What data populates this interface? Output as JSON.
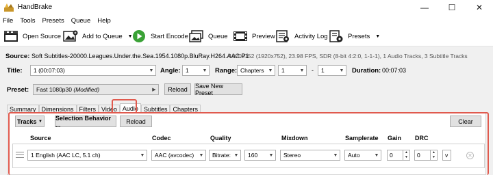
{
  "app": {
    "title": "HandBrake"
  },
  "menu": [
    "File",
    "Tools",
    "Presets",
    "Queue",
    "Help"
  ],
  "toolbar": {
    "open_source": "Open Source",
    "add_to_queue": "Add to Queue",
    "start_encode": "Start Encode",
    "queue": "Queue",
    "preview": "Preview",
    "activity_log": "Activity Log",
    "presets": "Presets"
  },
  "source": {
    "label": "Source:",
    "name": "Soft Subtitles-20000.Leagues.Under.the.Sea.1954.1080p.BluRay.H264.AAC.P1",
    "info": "1920x752 (1920x752), 23.98 FPS, SDR (8-bit 4:2:0, 1-1-1), 1 Audio Tracks, 3 Subtitle Tracks"
  },
  "title_row": {
    "title_label": "Title:",
    "title_value": "1 (00:07:03)",
    "angle_label": "Angle:",
    "angle_value": "1",
    "range_label": "Range:",
    "range_type": "Chapters",
    "range_start": "1",
    "range_sep": "-",
    "range_end": "1",
    "duration_label": "Duration:",
    "duration_value": "00:07:03"
  },
  "preset": {
    "label": "Preset:",
    "value": "Fast 1080p30",
    "modified": "(Modified)",
    "reload": "Reload",
    "save_new": "Save New Preset"
  },
  "tabs": [
    "Summary",
    "Dimensions",
    "Filters",
    "Video",
    "Audio",
    "Subtitles",
    "Chapters"
  ],
  "active_tab": "Audio",
  "audio": {
    "tracks_btn": "Tracks",
    "selection_behavior": "Selection Behavior ...",
    "reload": "Reload",
    "clear": "Clear",
    "columns": {
      "source": "Source",
      "codec": "Codec",
      "quality": "Quality",
      "mixdown": "Mixdown",
      "samplerate": "Samplerate",
      "gain": "Gain",
      "drc": "DRC"
    },
    "row": {
      "source": "1 English (AAC LC, 5.1 ch)",
      "codec": "AAC (avcodec)",
      "quality_mode": "Bitrate:",
      "bitrate": "160",
      "mixdown": "Stereo",
      "samplerate": "Auto",
      "gain": "0",
      "drc": "0",
      "extra": "v"
    }
  },
  "colors": {
    "highlight": "#e05a4e",
    "play_green": "#3aa236"
  }
}
